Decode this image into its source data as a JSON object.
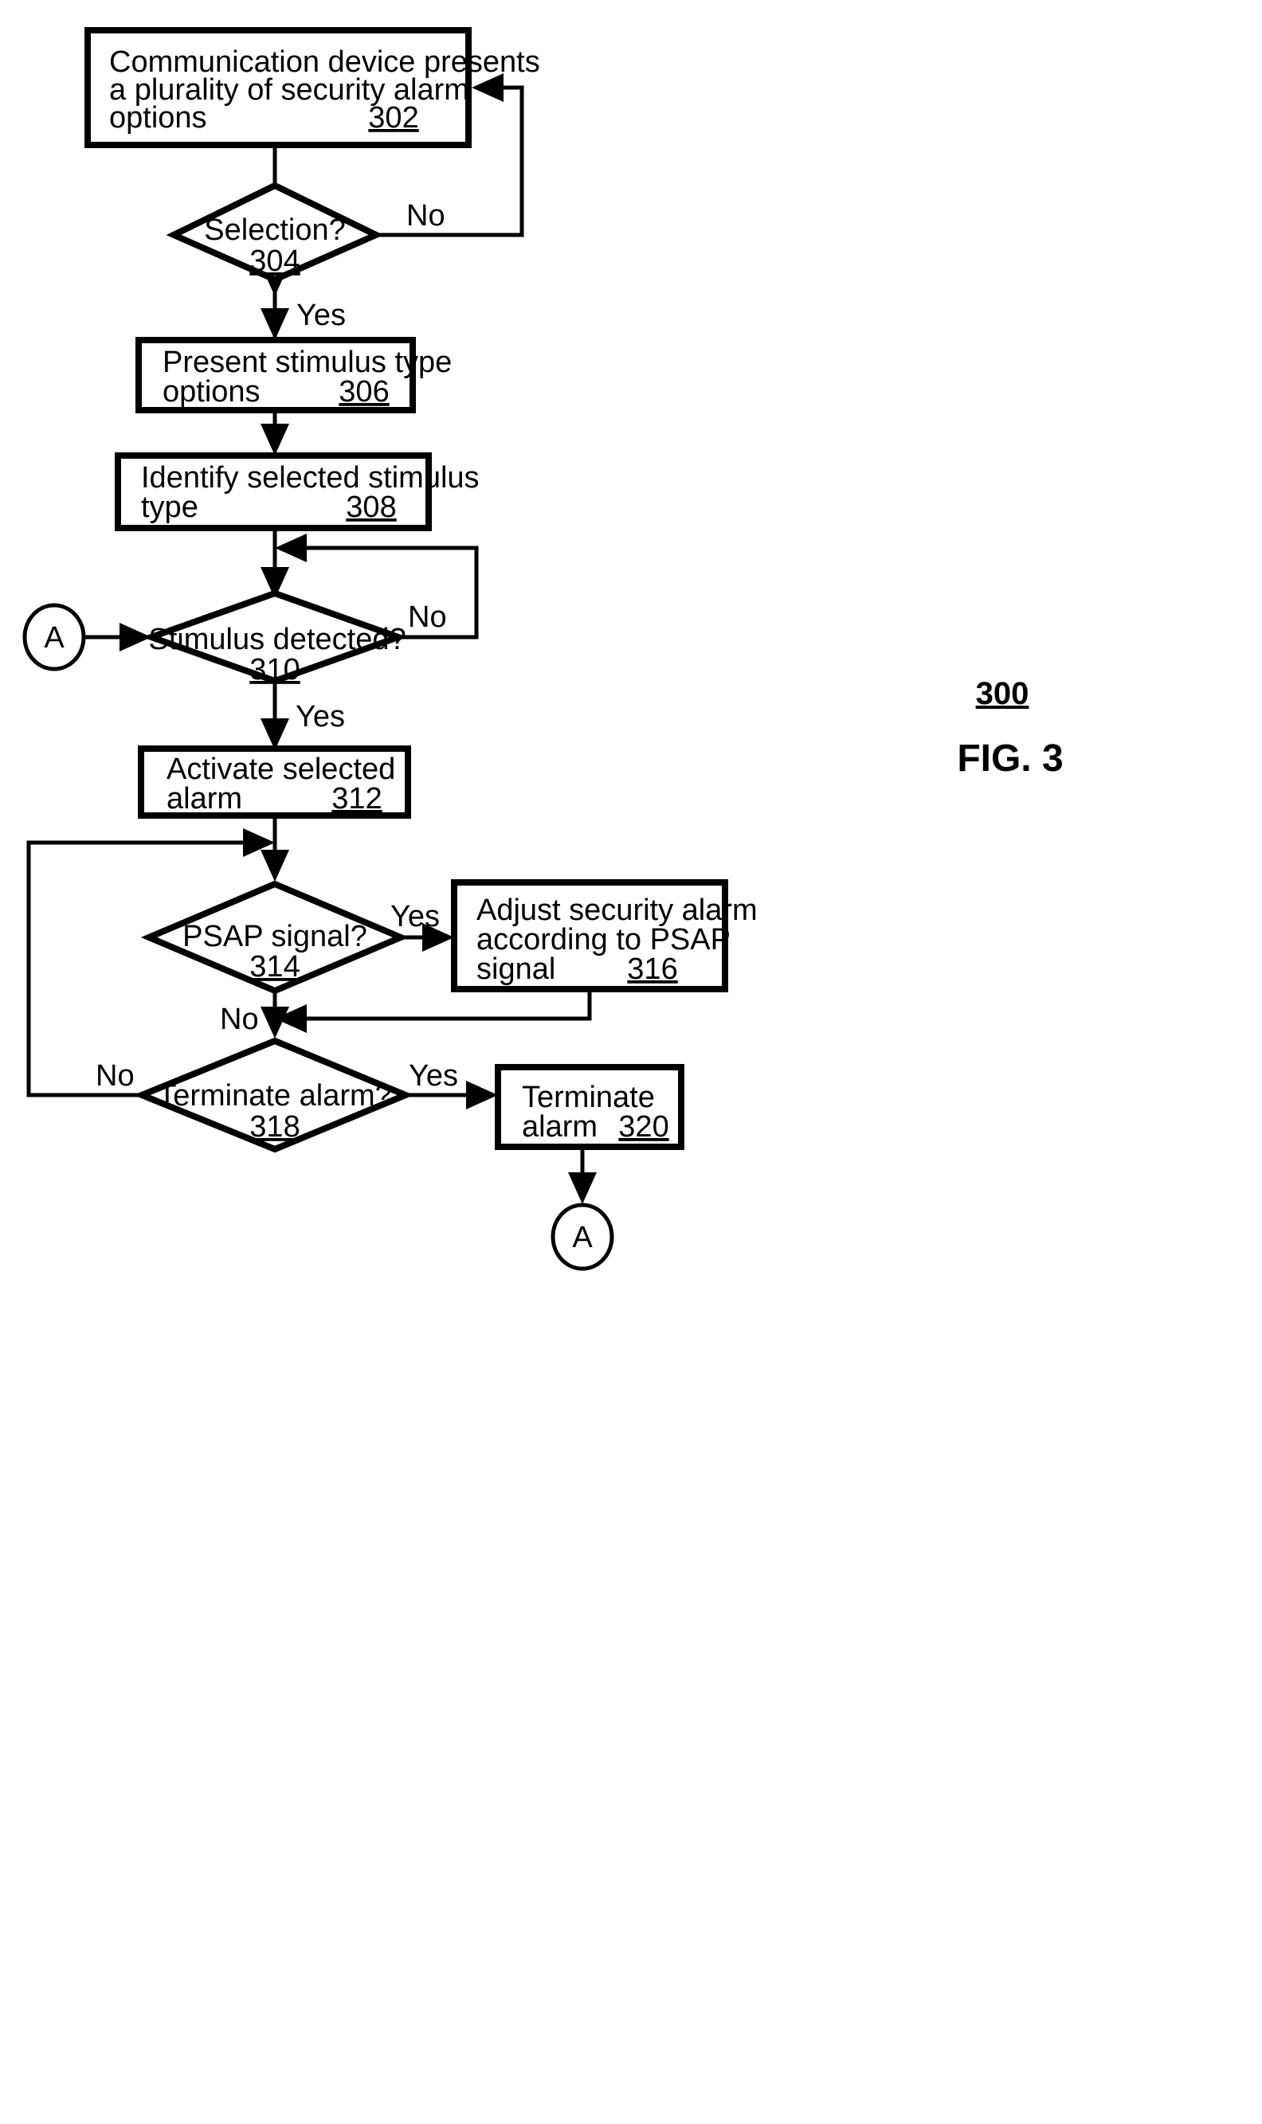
{
  "figure": {
    "number_label": "300",
    "title": "FIG. 3"
  },
  "nodes": {
    "n302": {
      "kind": "process",
      "lines": [
        "Communication device presents",
        "a plurality of security alarm",
        "options"
      ],
      "ref": "302"
    },
    "n304": {
      "kind": "decision",
      "lines": [
        "Selection?"
      ],
      "ref": "304"
    },
    "n306": {
      "kind": "process",
      "lines": [
        "Present stimulus type",
        "options"
      ],
      "ref": "306"
    },
    "n308": {
      "kind": "process",
      "lines": [
        "Identify selected stimulus",
        "type"
      ],
      "ref": "308"
    },
    "n310": {
      "kind": "decision",
      "lines": [
        "Stimulus detected?"
      ],
      "ref": "310"
    },
    "n312": {
      "kind": "process",
      "lines": [
        "Activate selected",
        "alarm"
      ],
      "ref": "312"
    },
    "n314": {
      "kind": "decision",
      "lines": [
        "PSAP signal?"
      ],
      "ref": "314"
    },
    "n316": {
      "kind": "process",
      "lines": [
        "Adjust security alarm",
        "according to PSAP",
        "signal"
      ],
      "ref": "316"
    },
    "n318": {
      "kind": "decision",
      "lines": [
        "Terminate alarm?"
      ],
      "ref": "318"
    },
    "n320": {
      "kind": "process",
      "lines": [
        "Terminate",
        "alarm"
      ],
      "ref": "320"
    },
    "conn_a_in": {
      "kind": "connector",
      "label": "A"
    },
    "conn_a_out": {
      "kind": "connector",
      "label": "A"
    }
  },
  "edge_labels": {
    "e304_no": "No",
    "e304_yes": "Yes",
    "e310_no": "No",
    "e310_yes": "Yes",
    "e314_yes": "Yes",
    "e314_no": "No",
    "e318_yes": "Yes",
    "e318_no": "No"
  },
  "colors": {
    "ink": "#000000",
    "paper": "#ffffff"
  }
}
